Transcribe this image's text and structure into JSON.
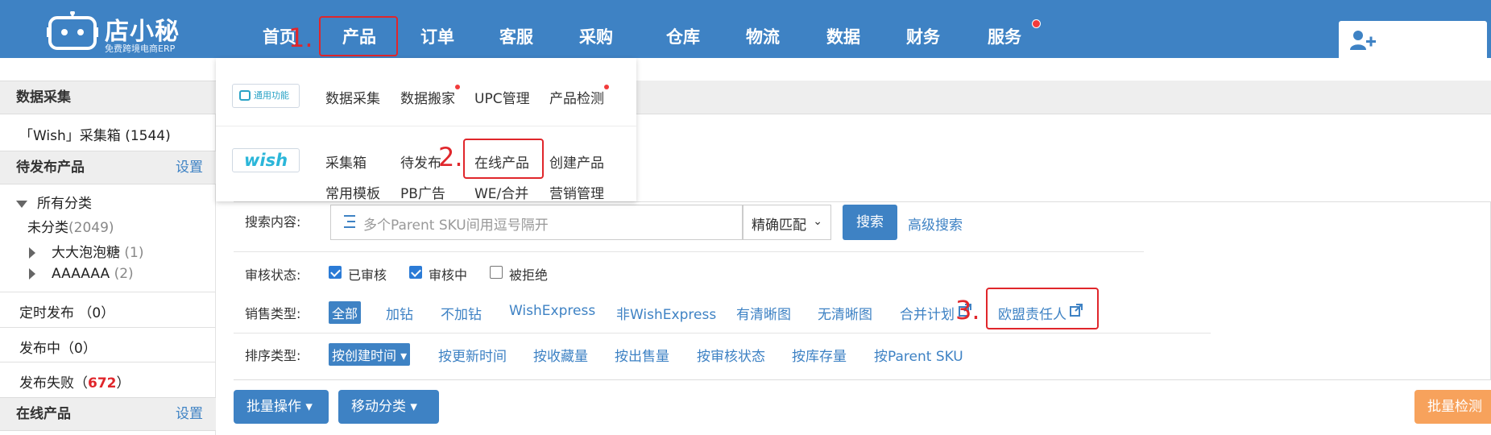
{
  "brand": {
    "title": "店小秘",
    "subtitle": "免费跨境电商ERP"
  },
  "nav": {
    "items": [
      "首页",
      "产品",
      "订单",
      "客服",
      "采购",
      "仓库",
      "物流",
      "数据",
      "财务",
      "服务"
    ]
  },
  "markers": [
    "1.",
    "2.",
    "3."
  ],
  "sidebar": {
    "data_collect": "数据采集",
    "collect_box": "「Wish」采集箱 (1544)",
    "pending": "待发布产品",
    "setting": "设置",
    "all_cat": "所有分类",
    "uncat": "未分类",
    "uncat_count": "(2049)",
    "cat1": "大大泡泡糖",
    "cat1_count": "(1)",
    "cat2": "AAAAAA",
    "cat2_count": "(2)",
    "scheduled": "定时发布 （0）",
    "publishing": "发布中（0）",
    "failed": "发布失败（",
    "failed_count": "672",
    "failed_end": "）",
    "online": "在线产品",
    "online_setting": "设置"
  },
  "dropdown": {
    "general_badge": "通用功能",
    "general": [
      "数据采集",
      "数据搬家",
      "UPC管理",
      "产品检测"
    ],
    "wish_badge": "wish",
    "wish_row1": [
      "采集箱",
      "待发布",
      "在线产品",
      "创建产品"
    ],
    "wish_row2": [
      "常用模板",
      "PB广告",
      "WE/合并",
      "营销管理"
    ]
  },
  "search": {
    "label": "搜索内容:",
    "placeholder": "多个Parent SKU间用逗号隔开",
    "match": "精确匹配",
    "button": "搜索",
    "advanced": "高级搜索"
  },
  "review": {
    "label": "审核状态:",
    "options": [
      "已审核",
      "审核中",
      "被拒绝"
    ]
  },
  "sales": {
    "label": "销售类型:",
    "options": [
      "全部",
      "加钻",
      "不加钻",
      "WishExpress",
      "非WishExpress",
      "有清晰图",
      "无清晰图",
      "合并计划",
      "欧盟责任人"
    ]
  },
  "sort": {
    "label": "排序类型:",
    "active": "按创建时间",
    "options": [
      "按更新时间",
      "按收藏量",
      "按出售量",
      "按审核状态",
      "按库存量",
      "按Parent SKU"
    ]
  },
  "actions": {
    "batch": "批量操作",
    "move": "移动分类",
    "batch_check": "批量检测"
  },
  "colors": {
    "primary": "#3e82c4",
    "annotation": "#e0262b",
    "orange": "#f7a25c"
  }
}
